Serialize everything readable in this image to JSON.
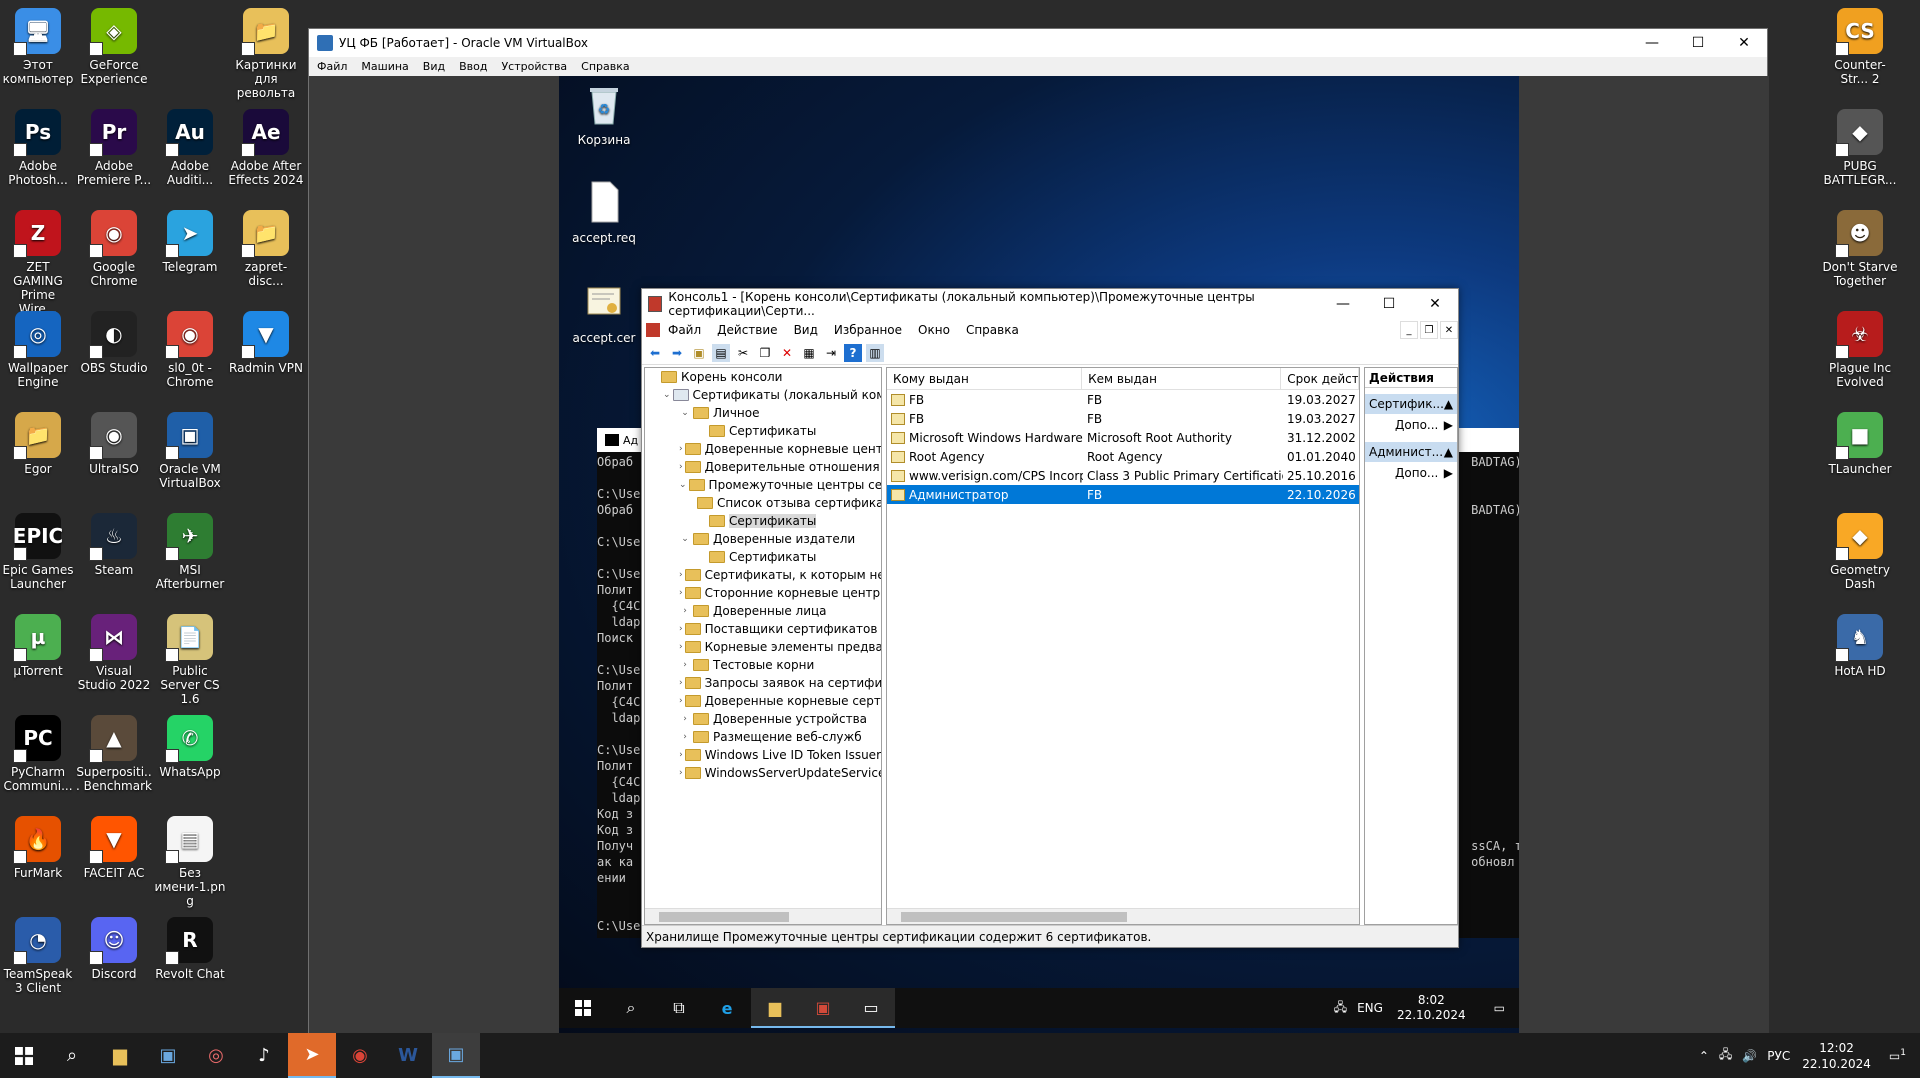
{
  "host_desktop": {
    "icons": [
      {
        "label": "Этот компьютер",
        "color": "#3a8ee6",
        "glyph": "🖥"
      },
      {
        "label": "GeForce Experience",
        "color": "#76b900",
        "glyph": "◈"
      },
      {
        "label": "Картинки для револьта",
        "color": "#e8c05a",
        "glyph": "📁"
      },
      {
        "label": "Adobe Photosh...",
        "color": "#001e36",
        "glyph": "Ps"
      },
      {
        "label": "Adobe Premiere P...",
        "color": "#2a0a4a",
        "glyph": "Pr"
      },
      {
        "label": "Adobe Auditi...",
        "color": "#00203a",
        "glyph": "Au"
      },
      {
        "label": "Adobe After Effects 2024",
        "color": "#1a0a3a",
        "glyph": "Ae"
      },
      {
        "label": "ZET GAMING Prime Wire...",
        "color": "#c0141c",
        "glyph": "Z"
      },
      {
        "label": "Google Chrome",
        "color": "#db4437",
        "glyph": "◉"
      },
      {
        "label": "Telegram",
        "color": "#2aa3df",
        "glyph": "➤"
      },
      {
        "label": "zapret-disc...",
        "color": "#e8c05a",
        "glyph": "📁"
      },
      {
        "label": "Wallpaper Engine",
        "color": "#1565c0",
        "glyph": "◎"
      },
      {
        "label": "OBS Studio",
        "color": "#222222",
        "glyph": "◐"
      },
      {
        "label": "sl0_0t - Chrome",
        "color": "#db4437",
        "glyph": "◉"
      },
      {
        "label": "Radmin VPN",
        "color": "#1e88e5",
        "glyph": "▼"
      },
      {
        "label": "Egor",
        "color": "#d6a84a",
        "glyph": "📁"
      },
      {
        "label": "UltraISO",
        "color": "#555555",
        "glyph": "◉"
      },
      {
        "label": "Oracle VM VirtualBox",
        "color": "#1f5fa8",
        "glyph": "▣"
      },
      {
        "label": "Epic Games Launcher",
        "color": "#111111",
        "glyph": "EPIC"
      },
      {
        "label": "Steam",
        "color": "#1b2838",
        "glyph": "♨"
      },
      {
        "label": "MSI Afterburner",
        "color": "#2e7d32",
        "glyph": "✈"
      },
      {
        "label": "µTorrent",
        "color": "#4caf50",
        "glyph": "µ"
      },
      {
        "label": "Visual Studio 2022",
        "color": "#68217a",
        "glyph": "⋈"
      },
      {
        "label": "Public Server CS 1.6",
        "color": "#d6c37a",
        "glyph": "📄"
      },
      {
        "label": "PyCharm Communi...",
        "color": "#000000",
        "glyph": "PC"
      },
      {
        "label": "Superpositi... Benchmark",
        "color": "#5a4a3a",
        "glyph": "▲"
      },
      {
        "label": "WhatsApp",
        "color": "#25d366",
        "glyph": "✆"
      },
      {
        "label": "FurMark",
        "color": "#e65100",
        "glyph": "🔥"
      },
      {
        "label": "FACEIT AC",
        "color": "#ff5500",
        "glyph": "▼"
      },
      {
        "label": "Без имени-1.png",
        "color": "#f5f5f5",
        "glyph": "▤"
      },
      {
        "label": "TeamSpeak 3 Client",
        "color": "#2a5caa",
        "glyph": "◔"
      },
      {
        "label": "Discord",
        "color": "#5865f2",
        "glyph": "☺"
      },
      {
        "label": "Revolt Chat",
        "color": "#111111",
        "glyph": "R"
      }
    ],
    "right_icons": [
      {
        "label": "Counter-Str... 2",
        "color": "#f0a020",
        "glyph": "CS"
      },
      {
        "label": "PUBG BATTLEGR...",
        "color": "#555555",
        "glyph": "◆"
      },
      {
        "label": "Don't Starve Together",
        "color": "#8a6a3a",
        "glyph": "☻"
      },
      {
        "label": "Plague Inc Evolved",
        "color": "#b71c1c",
        "glyph": "☣"
      },
      {
        "label": "TLauncher",
        "color": "#4caf50",
        "glyph": "■"
      },
      {
        "label": "Geometry Dash",
        "color": "#f9a825",
        "glyph": "◆"
      },
      {
        "label": "HotA HD",
        "color": "#3a6aa8",
        "glyph": "♞"
      }
    ]
  },
  "vbox": {
    "title": "УЦ ФБ [Работает] - Oracle VM VirtualBox",
    "menu": [
      "Файл",
      "Машина",
      "Вид",
      "Ввод",
      "Устройства",
      "Справка"
    ],
    "btn_min": "—",
    "btn_max": "☐",
    "btn_close": "✕"
  },
  "vm_desktop": {
    "icons": [
      {
        "label": "Корзина"
      },
      {
        "label": "accept.req"
      },
      {
        "label": "accept.cer"
      }
    ]
  },
  "cmd": {
    "title": "Ад",
    "lines": [
      "Обраб                                                                                                                    BADTAG)",
      "",
      "C:\\Use",
      "Обраб                                                                                                                    BADTAG)",
      "",
      "C:\\Use",
      "",
      "C:\\Use",
      "Полит",
      "  {C4C",
      "  ldap",
      "Поиск",
      "",
      "C:\\Use",
      "Полит",
      "  {C4C",
      "  ldap",
      "",
      "C:\\Use",
      "Полит",
      "  {C4C",
      "  ldap",
      "Код з",
      "Код з",
      "Получ                                                                                                                    ssCA, т",
      "ак ка                                                                                                                    обновл",
      "ении ",
      "",
      "",
      "C:\\Users\\Администратор>"
    ]
  },
  "mmc": {
    "title": "Консоль1 - [Корень консоли\\Сертификаты (локальный компьютер)\\Промежуточные центры сертификации\\Серти...",
    "menu": [
      "Файл",
      "Действие",
      "Вид",
      "Избранное",
      "Окно",
      "Справка"
    ],
    "btn_min": "—",
    "btn_max": "☐",
    "btn_close": "✕",
    "tree": [
      {
        "label": "Корень консоли",
        "indent": 0,
        "exp": ""
      },
      {
        "label": "Сертификаты (локальный компью",
        "indent": 1,
        "exp": "v"
      },
      {
        "label": "Личное",
        "indent": 2,
        "exp": "v"
      },
      {
        "label": "Сертификаты",
        "indent": 3,
        "exp": ""
      },
      {
        "label": "Доверенные корневые центры",
        "indent": 2,
        "exp": ">"
      },
      {
        "label": "Доверительные отношения в п",
        "indent": 2,
        "exp": ">"
      },
      {
        "label": "Промежуточные центры серти",
        "indent": 2,
        "exp": "v"
      },
      {
        "label": "Список отзыва сертификат",
        "indent": 3,
        "exp": ""
      },
      {
        "label": "Сертификаты",
        "indent": 3,
        "exp": "",
        "selected": true
      },
      {
        "label": "Доверенные издатели",
        "indent": 2,
        "exp": "v"
      },
      {
        "label": "Сертификаты",
        "indent": 3,
        "exp": ""
      },
      {
        "label": "Сертификаты, к которым нет до",
        "indent": 2,
        "exp": ">"
      },
      {
        "label": "Сторонние корневые центры се",
        "indent": 2,
        "exp": ">"
      },
      {
        "label": "Доверенные лица",
        "indent": 2,
        "exp": ">"
      },
      {
        "label": "Поставщики сертификатов про",
        "indent": 2,
        "exp": ">"
      },
      {
        "label": "Корневые элементы предварит",
        "indent": 2,
        "exp": ">"
      },
      {
        "label": "Тестовые корни",
        "indent": 2,
        "exp": ">"
      },
      {
        "label": "Запросы заявок на сертификат",
        "indent": 2,
        "exp": ">"
      },
      {
        "label": "Доверенные корневые сертифи",
        "indent": 2,
        "exp": ">"
      },
      {
        "label": "Доверенные устройства",
        "indent": 2,
        "exp": ">"
      },
      {
        "label": "Размещение веб-служб",
        "indent": 2,
        "exp": ">"
      },
      {
        "label": "Windows Live ID Token Issuer",
        "indent": 2,
        "exp": ">"
      },
      {
        "label": "WindowsServerUpdateServices",
        "indent": 2,
        "exp": ">"
      }
    ],
    "columns": [
      "Кому выдан",
      "Кем выдан",
      "Срок действ"
    ],
    "rows": [
      {
        "issued_to": "FB",
        "issued_by": "FB",
        "expires": "19.03.2027"
      },
      {
        "issued_to": "FB",
        "issued_by": "FB",
        "expires": "19.03.2027"
      },
      {
        "issued_to": "Microsoft Windows Hardware ...",
        "issued_by": "Microsoft Root Authority",
        "expires": "31.12.2002"
      },
      {
        "issued_to": "Root Agency",
        "issued_by": "Root Agency",
        "expires": "01.01.2040"
      },
      {
        "issued_to": "www.verisign.com/CPS Incorp....",
        "issued_by": "Class 3 Public Primary Certificatio...",
        "expires": "25.10.2016"
      },
      {
        "issued_to": "Администратор",
        "issued_by": "FB",
        "expires": "22.10.2026",
        "selected": true
      }
    ],
    "actions_header": "Действия",
    "actions": [
      {
        "section": "Сертифик...",
        "item": "Допо..."
      },
      {
        "section": "Админист...",
        "item": "Допо..."
      }
    ],
    "status": "Хранилище Промежуточные центры сертификации содержит 6 сертификатов."
  },
  "vm_taskbar": {
    "lang": "ENG",
    "time": "8:02",
    "date": "22.10.2024"
  },
  "host_taskbar": {
    "lang": "РУС",
    "time": "12:02",
    "date": "22.10.2024",
    "notif_count": "1"
  }
}
